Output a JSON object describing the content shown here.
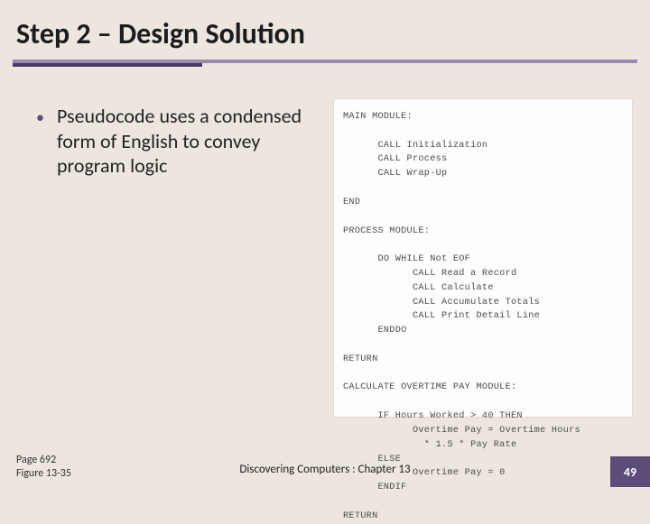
{
  "title": "Step 2 – Design Solution",
  "bullet": {
    "text": "Pseudocode uses a condensed form of English to convey program logic"
  },
  "pseudocode": "MAIN MODULE:\n\n      CALL Initialization\n      CALL Process\n      CALL Wrap-Up\n\nEND\n\nPROCESS MODULE:\n\n      DO WHILE Not EOF\n            CALL Read a Record\n            CALL Calculate\n            CALL Accumulate Totals\n            CALL Print Detail Line\n      ENDDO\n\nRETURN\n\nCALCULATE OVERTIME PAY MODULE:\n\n      IF Hours Worked > 40 THEN\n            Overtime Pay = Overtime Hours\n              * 1.5 * Pay Rate\n      ELSE\n            Overtime Pay = 0\n      ENDIF\n\nRETURN",
  "pageRef": {
    "line1": "Page 692",
    "line2": "Figure 13-35"
  },
  "footer": "Discovering Computers : Chapter 13",
  "slideNumber": "49"
}
